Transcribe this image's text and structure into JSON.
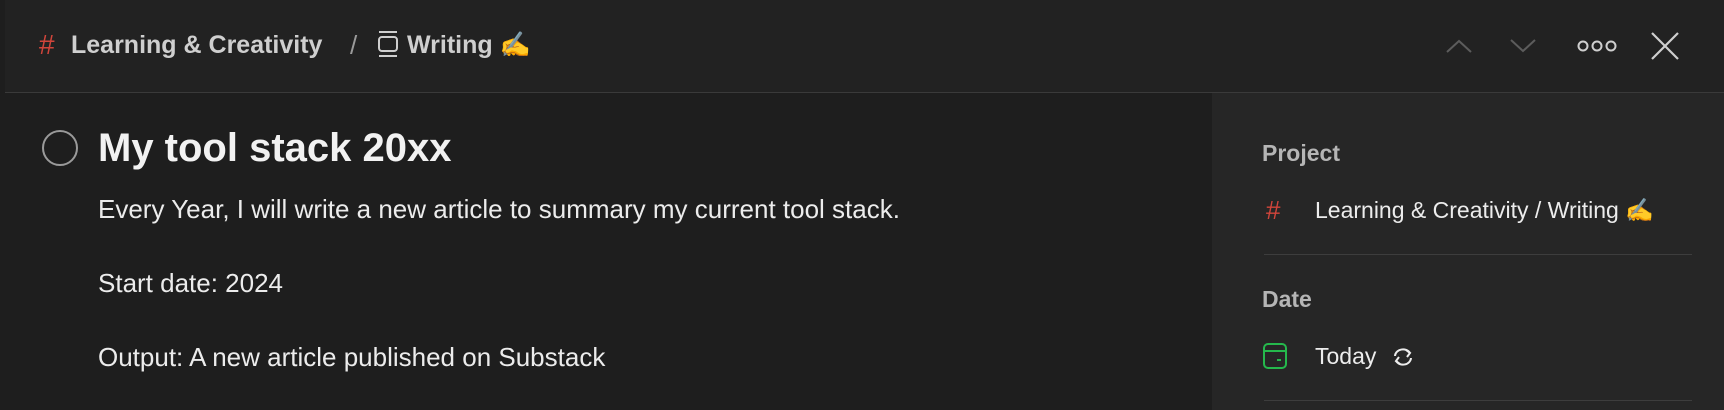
{
  "breadcrumb": {
    "project_icon": "hash-icon",
    "project": "Learning & Creativity",
    "separator": "/",
    "section_icon": "section-icon",
    "section": "Writing ✍️"
  },
  "header_actions": [
    {
      "name": "previous-task-button",
      "icon": "chevron-up-icon"
    },
    {
      "name": "next-task-button",
      "icon": "chevron-down-icon"
    },
    {
      "name": "more-actions-button",
      "icon": "more-horizontal-icon"
    },
    {
      "name": "close-button",
      "icon": "close-icon"
    }
  ],
  "task": {
    "title": "My tool stack 20xx",
    "description": [
      "Every Year, I will write a new article to summary my current tool stack.",
      "Start date: 2024",
      "Output: A new article published on Substack"
    ]
  },
  "sidebar": {
    "project_label": "Project",
    "project_icon": "hash-icon",
    "project_value": "Learning & Creativity / Writing ✍️",
    "date_label": "Date",
    "date_icon": "calendar-icon",
    "date_value": "Today",
    "recurring_icon": "recurring-icon"
  },
  "colors": {
    "accent_red": "#d1453b",
    "date_green": "#25b84c",
    "background": "#1e1e1e",
    "sidebar_background": "#262626"
  }
}
